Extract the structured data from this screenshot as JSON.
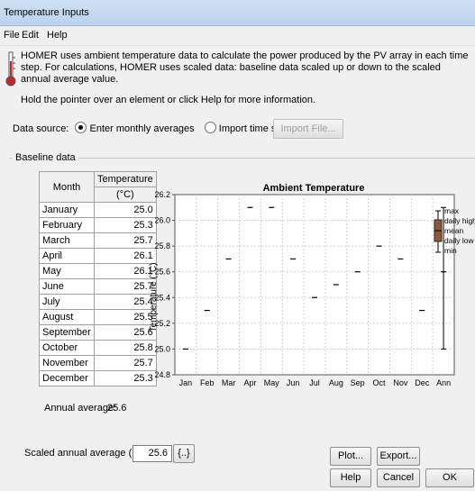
{
  "window": {
    "title": "Temperature Inputs"
  },
  "menu": [
    "File",
    "Edit",
    "Help"
  ],
  "info": {
    "line1": "HOMER uses ambient temperature data to calculate the power produced by the PV array in each time step. For calculations, HOMER uses scaled data: baseline data scaled up or down to the scaled annual average value.",
    "hint": "Hold the pointer over an element or click Help for more information."
  },
  "data_source": {
    "label": "Data source:",
    "option_monthly": "Enter monthly averages",
    "option_timeseries": "Import time series data file",
    "selected": "monthly",
    "import_button": "Import File..."
  },
  "baseline": {
    "group_label": "Baseline data",
    "col_month": "Month",
    "col_temp": "Temperature",
    "col_unit": "(°C)",
    "rows": [
      {
        "month": "January",
        "temp": "25.0"
      },
      {
        "month": "February",
        "temp": "25.3"
      },
      {
        "month": "March",
        "temp": "25.7"
      },
      {
        "month": "April",
        "temp": "26.1"
      },
      {
        "month": "May",
        "temp": "26.1"
      },
      {
        "month": "June",
        "temp": "25.7"
      },
      {
        "month": "July",
        "temp": "25.4"
      },
      {
        "month": "August",
        "temp": "25.5"
      },
      {
        "month": "September",
        "temp": "25.6"
      },
      {
        "month": "October",
        "temp": "25.8"
      },
      {
        "month": "November",
        "temp": "25.7"
      },
      {
        "month": "December",
        "temp": "25.3"
      }
    ],
    "annual_label": "Annual average:",
    "annual_value": "25.6"
  },
  "scaled": {
    "label": "Scaled annual average (°C)",
    "value": "25.6",
    "button": "{..}"
  },
  "buttons": {
    "plot": "Plot...",
    "export": "Export...",
    "help": "Help",
    "cancel": "Cancel",
    "ok": "OK"
  },
  "chart_data": {
    "type": "scatter",
    "title": "Ambient Temperature",
    "ylabel": "Temperature (°C)",
    "ylim": [
      24.8,
      26.2
    ],
    "yticks": [
      "26.2",
      "26.0",
      "25.8",
      "25.6",
      "25.4",
      "25.2",
      "25.0",
      "24.8"
    ],
    "categories": [
      "Jan",
      "Feb",
      "Mar",
      "Apr",
      "May",
      "Jun",
      "Jul",
      "Aug",
      "Sep",
      "Oct",
      "Nov",
      "Dec",
      "Ann"
    ],
    "values": [
      25.0,
      25.3,
      25.7,
      26.1,
      26.1,
      25.7,
      25.4,
      25.5,
      25.6,
      25.8,
      25.7,
      25.3,
      25.6
    ],
    "annual_range": {
      "max": 26.1,
      "min": 25.0,
      "mean": 25.6
    },
    "legend": [
      "max",
      "daily high",
      "mean",
      "daily low",
      "min"
    ],
    "legend_color": "#8b5a3c",
    "grid": true
  }
}
